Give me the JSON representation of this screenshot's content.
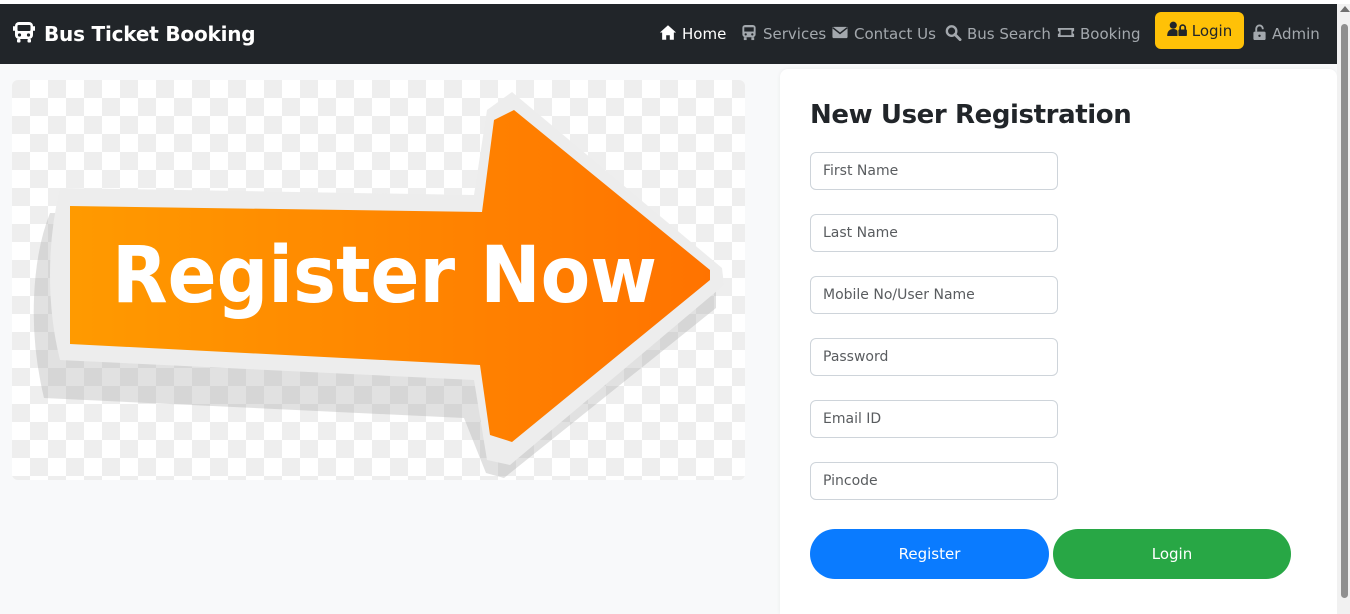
{
  "navbar": {
    "brand": "Bus Ticket Booking",
    "items": [
      {
        "label": "Home",
        "icon": "home-icon"
      },
      {
        "label": "Services",
        "icon": "bus-icon"
      },
      {
        "label": "Contact Us",
        "icon": "envelope-icon"
      },
      {
        "label": "Bus Search",
        "icon": "search-icon"
      },
      {
        "label": "Booking",
        "icon": "ticket-icon"
      }
    ],
    "login_label": "Login",
    "admin_label": "Admin"
  },
  "banner": {
    "text": "Register Now"
  },
  "form": {
    "title": "New User Registration",
    "fields": [
      {
        "placeholder": "First Name"
      },
      {
        "placeholder": "Last Name"
      },
      {
        "placeholder": "Mobile No/User Name"
      },
      {
        "placeholder": "Password"
      },
      {
        "placeholder": "Email ID"
      },
      {
        "placeholder": "Pincode"
      }
    ],
    "register_label": "Register",
    "login_label": "Login"
  },
  "colors": {
    "navbar": "#212529",
    "login_button": "#ffc107",
    "register_button": "#0a7bff",
    "form_login_button": "#28a745",
    "arrow": "#ff7a00"
  }
}
